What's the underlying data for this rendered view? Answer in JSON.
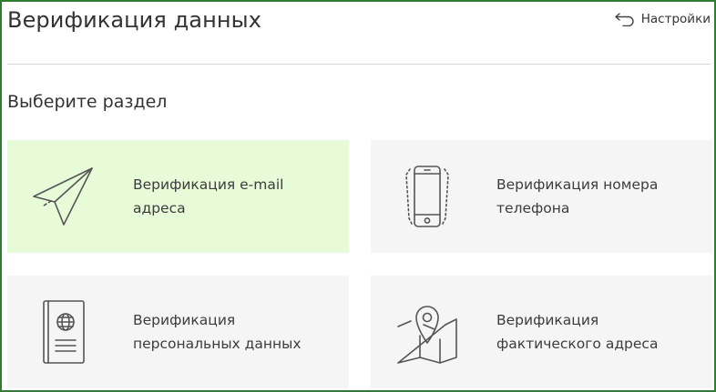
{
  "header": {
    "title": "Верификация данных",
    "settings_label": "Настройки",
    "settings_icon": "back-arrow-icon"
  },
  "section": {
    "title": "Выберите раздел"
  },
  "cards": [
    {
      "line1": "Верификация e-mail",
      "line2": "адреса",
      "icon": "paper-plane-icon",
      "active": true
    },
    {
      "line1": "Верификация номера",
      "line2": "телефона",
      "icon": "smartphone-icon",
      "active": false
    },
    {
      "line1": "Верификация",
      "line2": "персональных данных",
      "icon": "passport-icon",
      "active": false
    },
    {
      "line1": "Верификация",
      "line2": "фактического адреса",
      "icon": "map-pin-icon",
      "active": false
    }
  ],
  "colors": {
    "frame_border": "#2e7d32",
    "active_card_bg": "#e8fbd8",
    "card_bg": "#f5f5f5",
    "icon_stroke": "#555555"
  }
}
